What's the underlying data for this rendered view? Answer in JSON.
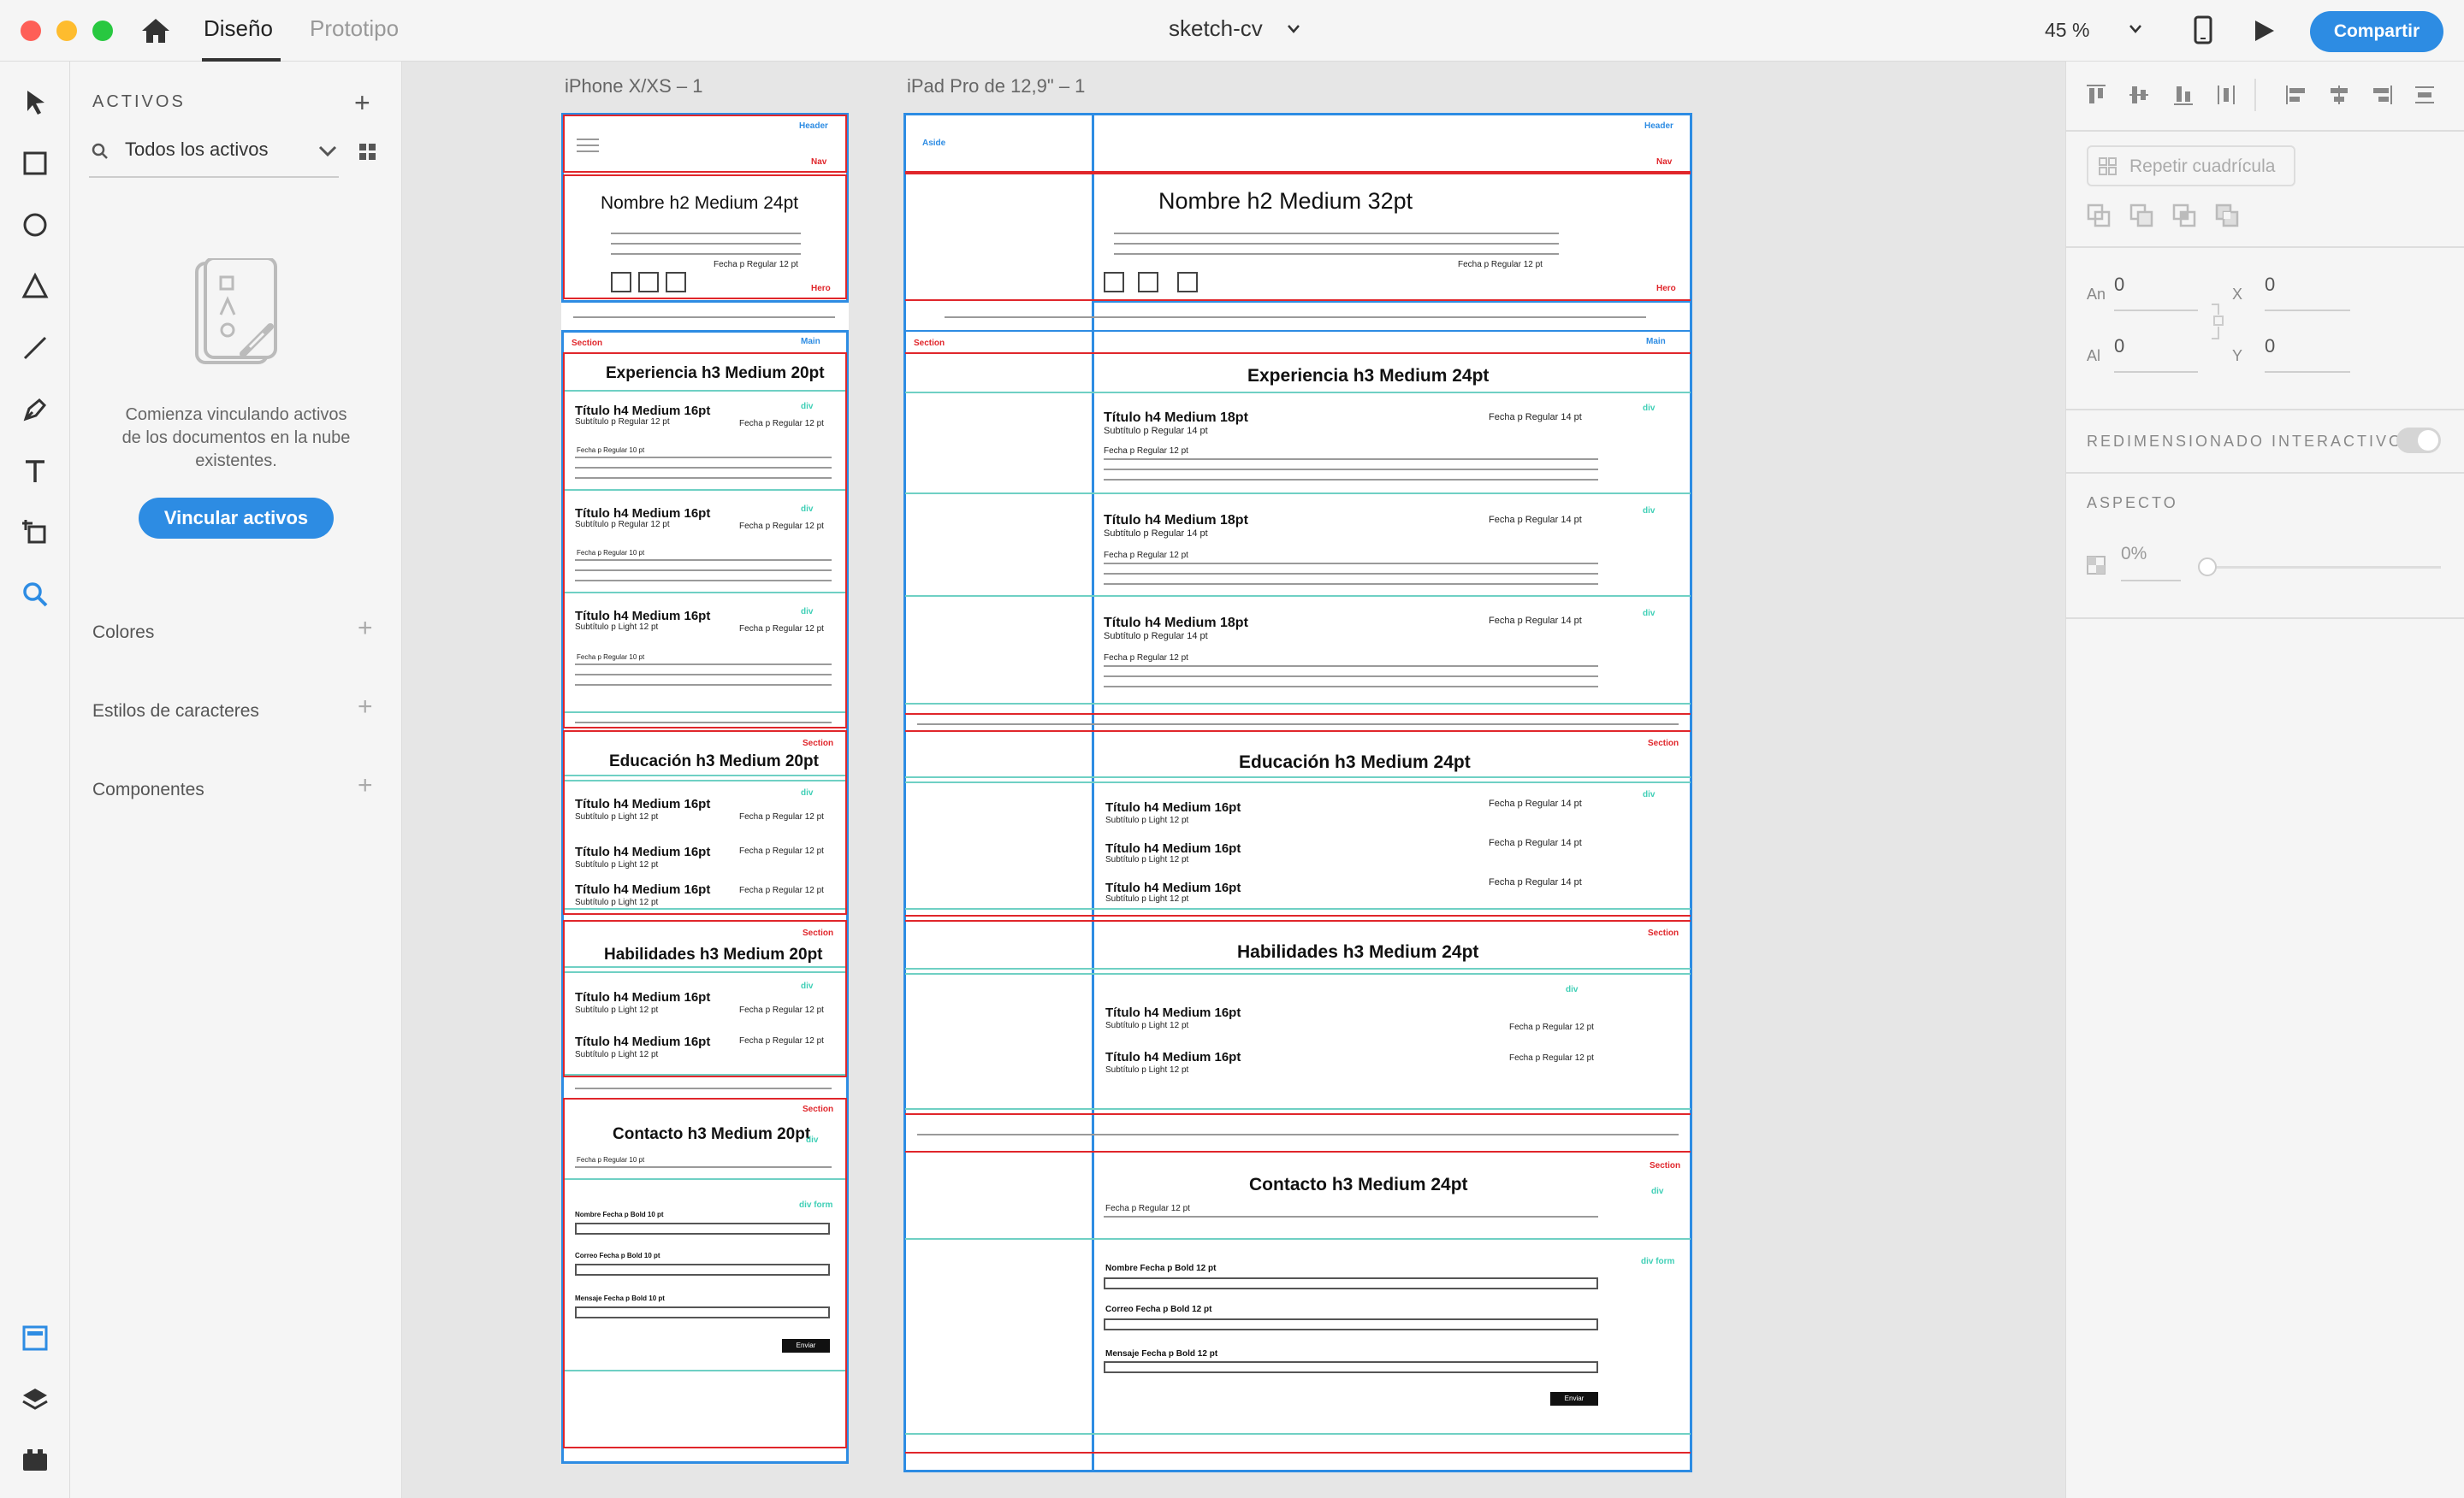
{
  "app": {
    "tabs": [
      "Diseño",
      "Prototipo"
    ],
    "doc_title": "sketch-cv",
    "zoom": "45 %",
    "share_label": "Compartir"
  },
  "assets": {
    "title": "ACTIVOS",
    "filter": "Todos los activos",
    "empty_text_1": "Comienza vinculando activos",
    "empty_text_2": "de los documentos en la nube",
    "empty_text_3": "existentes.",
    "link_button": "Vincular activos",
    "sections": [
      "Colores",
      "Estilos de caracteres",
      "Componentes"
    ]
  },
  "props": {
    "repeat_grid": "Repetir cuadrícula",
    "w_label": "An",
    "h_label": "Al",
    "x_label": "X",
    "y_label": "Y",
    "w": "0",
    "h": "0",
    "x": "0",
    "y": "0",
    "interactive_resize": "REDIMENSIONADO INTERACTIVO",
    "aspect": "ASPECTO",
    "opacity": "0%"
  },
  "iphone": {
    "name": "iPhone X/XS – 1",
    "header": "Header",
    "nav": "Nav",
    "hero": "Hero",
    "hero_title": "Nombre h2 Medium 24pt",
    "hero_date": "Fecha p Regular 12 pt",
    "section": "Section",
    "main": "Main",
    "div": "div",
    "exp_title": "Experiencia  h3 Medium 20pt",
    "item_title": "Título  h4 Medium 16pt",
    "item_sub_regular": "Subtítulo p Regular 12 pt",
    "item_sub_light": "Subtítulo p Light 12 pt",
    "item_date": "Fecha p Regular 12 pt",
    "item_small_date": "Fecha p Regular 10 pt",
    "edu_title": "Educación  h3 Medium 20pt",
    "skills_title": "Habilidades  h3 Medium 20pt",
    "contact_title": "Contacto  h3 Medium 20pt",
    "div_form": "div form",
    "form_name": "Nombre Fecha p Bold 10 pt",
    "form_email": "Correo Fecha p Bold 10 pt",
    "form_msg": "Mensaje Fecha p Bold 10 pt",
    "send": "Enviar"
  },
  "ipad": {
    "name": "iPad Pro de 12,9\" – 1",
    "aside": "Aside",
    "header": "Header",
    "nav": "Nav",
    "hero": "Hero",
    "hero_title": "Nombre h2 Medium 32pt",
    "hero_date": "Fecha p Regular 12 pt",
    "section": "Section",
    "main": "Main",
    "div": "div",
    "exp_title": "Experiencia  h3 Medium 24pt",
    "item_title_18": "Título  h4 Medium 18pt",
    "item_title_16": "Título  h4 Medium 16pt",
    "item_sub_14": "Subtítulo p Regular 14 pt",
    "item_sub_light": "Subtítulo p Light 12 pt",
    "item_date_14": "Fecha p Regular 14 pt",
    "item_date_12": "Fecha p Regular 12 pt",
    "item_small_date": "Fecha p Regular 12 pt",
    "edu_title": "Educación  h3 Medium 24pt",
    "skills_title": "Habilidades  h3 Medium 24pt",
    "contact_title": "Contacto  h3 Medium 24pt",
    "div_form": "div form",
    "form_name": "Nombre Fecha p Bold 12 pt",
    "form_email": "Correo Fecha p Bold 12 pt",
    "form_msg": "Mensaje Fecha p Bold 12 pt",
    "send": "Enviar"
  },
  "colors": {
    "accent": "#2d8ce3",
    "red": "#e0262b",
    "green": "#6fd0c4"
  }
}
